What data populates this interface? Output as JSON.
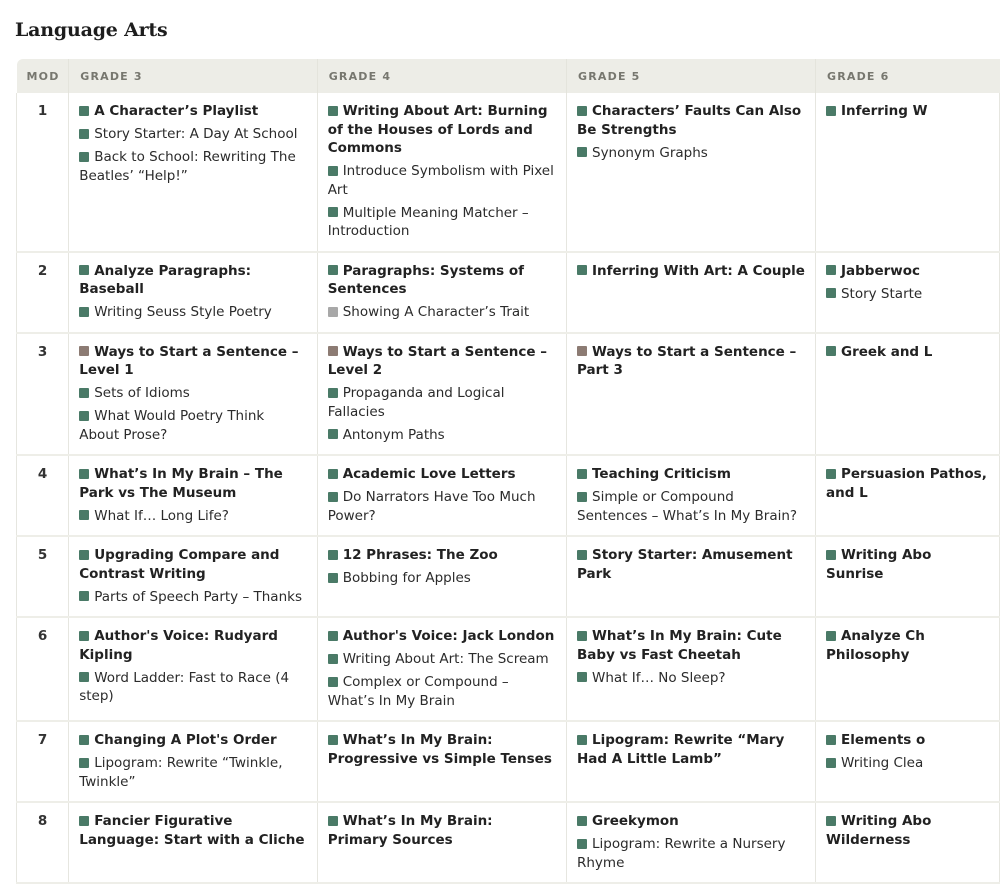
{
  "page_title": "Language Arts",
  "colors": {
    "green": "#4a7a67",
    "gray": "#a8a8a8",
    "brown": "#8c7b73",
    "header_bg": "#edede7"
  },
  "columns": [
    "MOD",
    "GRADE 3",
    "GRADE 4",
    "GRADE 5",
    "GRADE 6"
  ],
  "rows": [
    {
      "mod": "1",
      "cells": [
        [
          {
            "text": "A Character’s Playlist",
            "bold": true,
            "color": "green"
          },
          {
            "text": "Story Starter: A Day At School",
            "bold": false,
            "color": "green"
          },
          {
            "text": "Back to School: Rewriting The Beatles’ “Help!”",
            "bold": false,
            "color": "green"
          }
        ],
        [
          {
            "text": "Writing About Art: Burning of the Houses of Lords and Commons",
            "bold": true,
            "color": "green"
          },
          {
            "text": "Introduce Symbolism with Pixel Art",
            "bold": false,
            "color": "green"
          },
          {
            "text": "Multiple Meaning Matcher – Introduction",
            "bold": false,
            "color": "green"
          }
        ],
        [
          {
            "text": "Characters’ Faults Can Also Be Strengths",
            "bold": true,
            "color": "green"
          },
          {
            "text": "Synonym Graphs",
            "bold": false,
            "color": "green"
          }
        ],
        [
          {
            "text": "Inferring W",
            "bold": true,
            "color": "green"
          }
        ]
      ]
    },
    {
      "mod": "2",
      "cells": [
        [
          {
            "text": "Analyze Paragraphs: Baseball",
            "bold": true,
            "color": "green"
          },
          {
            "text": "Writing Seuss Style Poetry",
            "bold": false,
            "color": "green"
          }
        ],
        [
          {
            "text": "Paragraphs: Systems of Sentences",
            "bold": true,
            "color": "green"
          },
          {
            "text": "Showing A Character’s Trait",
            "bold": false,
            "color": "gray"
          }
        ],
        [
          {
            "text": "Inferring With Art: A Couple",
            "bold": true,
            "color": "green"
          }
        ],
        [
          {
            "text": "Jabberwoc",
            "bold": true,
            "color": "green"
          },
          {
            "text": "Story Starte",
            "bold": false,
            "color": "green"
          }
        ]
      ]
    },
    {
      "mod": "3",
      "cells": [
        [
          {
            "text": "Ways to Start a Sentence – Level 1",
            "bold": true,
            "color": "brown"
          },
          {
            "text": "Sets of Idioms",
            "bold": false,
            "color": "green"
          },
          {
            "text": "What Would Poetry Think About Prose?",
            "bold": false,
            "color": "green"
          }
        ],
        [
          {
            "text": "Ways to Start a Sentence – Level 2",
            "bold": true,
            "color": "brown"
          },
          {
            "text": "Propaganda and Logical Fallacies",
            "bold": false,
            "color": "green"
          },
          {
            "text": "Antonym Paths",
            "bold": false,
            "color": "green"
          }
        ],
        [
          {
            "text": "Ways to Start a Sentence – Part 3",
            "bold": true,
            "color": "brown"
          }
        ],
        [
          {
            "text": "Greek and L",
            "bold": true,
            "color": "green"
          }
        ]
      ]
    },
    {
      "mod": "4",
      "cells": [
        [
          {
            "text": "What’s In My Brain – The Park vs The Museum",
            "bold": true,
            "color": "green"
          },
          {
            "text": "What If… Long Life?",
            "bold": false,
            "color": "green"
          }
        ],
        [
          {
            "text": "Academic Love Letters",
            "bold": true,
            "color": "green"
          },
          {
            "text": "Do Narrators Have Too Much Power?",
            "bold": false,
            "color": "green"
          }
        ],
        [
          {
            "text": "Teaching Criticism",
            "bold": true,
            "color": "green"
          },
          {
            "text": "Simple or Compound Sentences – What’s In My Brain?",
            "bold": false,
            "color": "green"
          }
        ],
        [
          {
            "text": "Persuasion Pathos, and L",
            "bold": true,
            "color": "green"
          }
        ]
      ]
    },
    {
      "mod": "5",
      "cells": [
        [
          {
            "text": "Upgrading Compare and Contrast Writing",
            "bold": true,
            "color": "green"
          },
          {
            "text": "Parts of Speech Party – Thanks",
            "bold": false,
            "color": "green"
          }
        ],
        [
          {
            "text": "12 Phrases: The Zoo",
            "bold": true,
            "color": "green"
          },
          {
            "text": "Bobbing for Apples",
            "bold": false,
            "color": "green"
          }
        ],
        [
          {
            "text": "Story Starter: Amusement Park",
            "bold": true,
            "color": "green"
          }
        ],
        [
          {
            "text": "Writing Abo Sunrise",
            "bold": true,
            "color": "green"
          }
        ]
      ]
    },
    {
      "mod": "6",
      "cells": [
        [
          {
            "text": "Author's Voice: Rudyard Kipling",
            "bold": true,
            "color": "green"
          },
          {
            "text": "Word Ladder: Fast to Race (4 step)",
            "bold": false,
            "color": "green"
          }
        ],
        [
          {
            "text": "Author's Voice: Jack London",
            "bold": true,
            "color": "green"
          },
          {
            "text": "Writing About Art: The Scream",
            "bold": false,
            "color": "green"
          },
          {
            "text": "Complex or Compound – What’s In My Brain",
            "bold": false,
            "color": "green"
          }
        ],
        [
          {
            "text": "What’s In My Brain: Cute Baby vs Fast Cheetah",
            "bold": true,
            "color": "green"
          },
          {
            "text": "What If… No Sleep?",
            "bold": false,
            "color": "green"
          }
        ],
        [
          {
            "text": "Analyze Ch Philosophy",
            "bold": true,
            "color": "green"
          }
        ]
      ]
    },
    {
      "mod": "7",
      "cells": [
        [
          {
            "text": "Changing A Plot's Order",
            "bold": true,
            "color": "green"
          },
          {
            "text": "Lipogram: Rewrite “Twinkle, Twinkle”",
            "bold": false,
            "color": "green"
          }
        ],
        [
          {
            "text": "What’s In My Brain: Progressive vs Simple Tenses",
            "bold": true,
            "color": "green"
          }
        ],
        [
          {
            "text": "Lipogram: Rewrite “Mary Had A Little Lamb”",
            "bold": true,
            "color": "green"
          }
        ],
        [
          {
            "text": "Elements o",
            "bold": true,
            "color": "green"
          },
          {
            "text": "Writing Clea",
            "bold": false,
            "color": "green"
          }
        ]
      ]
    },
    {
      "mod": "8",
      "cells": [
        [
          {
            "text": "Fancier Figurative Language: Start with a Cliche",
            "bold": true,
            "color": "green"
          }
        ],
        [
          {
            "text": "What’s In My Brain: Primary Sources",
            "bold": true,
            "color": "green"
          }
        ],
        [
          {
            "text": "Greekymon",
            "bold": true,
            "color": "green"
          },
          {
            "text": "Lipogram: Rewrite a Nursery Rhyme",
            "bold": false,
            "color": "green"
          }
        ],
        [
          {
            "text": "Writing Abo Wilderness",
            "bold": true,
            "color": "green"
          }
        ]
      ]
    }
  ]
}
